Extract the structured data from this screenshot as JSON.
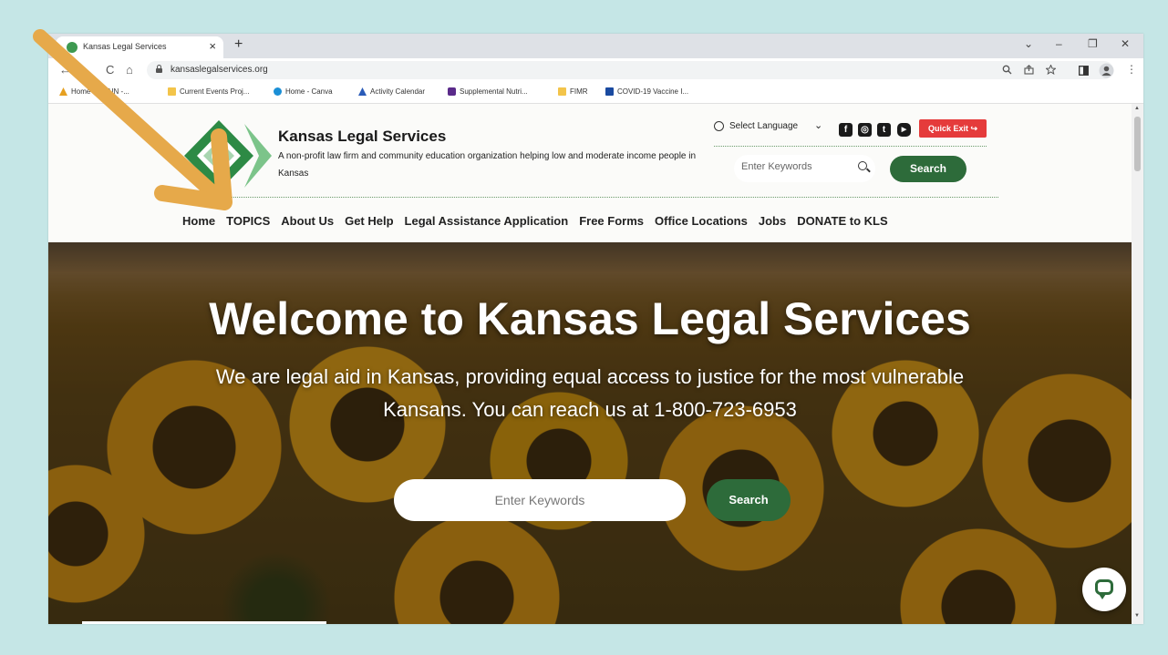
{
  "browser": {
    "tab_title": "Kansas Legal Services",
    "tab_close": "×",
    "new_tab": "+",
    "url": "kansaslegalservices.org",
    "window_controls": [
      "⌄",
      "–",
      "❐",
      "✕"
    ],
    "nav_icons": [
      "←",
      "C",
      "⌂"
    ],
    "bookmarks": [
      {
        "label": "Home - TRAIN -...",
        "icon": "train-icon",
        "color": "#e6a020"
      },
      {
        "label": "Current Events Proj...",
        "icon": "folder-icon",
        "color": "#f3c44a"
      },
      {
        "label": "Home - Canva",
        "icon": "canva-icon",
        "color": "#1a8fd6"
      },
      {
        "label": "Activity Calendar",
        "icon": "calendar-icon",
        "color": "#2a5bb8"
      },
      {
        "label": "Supplemental Nutri...",
        "icon": "bookmark-icon",
        "color": "#5a2a8a"
      },
      {
        "label": "FIMR",
        "icon": "folder-icon",
        "color": "#f3c44a"
      },
      {
        "label": "COVID-19 Vaccine I...",
        "icon": "bookmark-icon",
        "color": "#1a4aa0"
      }
    ]
  },
  "header": {
    "site_title": "Kansas Legal Services",
    "tagline": "A non-profit law firm and community education organization helping low and moderate income people in Kansas",
    "language_label": "Select Language",
    "language_chevron": "⌄",
    "social": [
      "f",
      "◎",
      "t",
      "▶"
    ],
    "quick_exit": "Quick Exit ↪",
    "search_placeholder": "Enter Keywords",
    "search_button": "Search"
  },
  "nav": [
    "Home",
    "TOPICS",
    "About Us",
    "Get Help",
    "Legal Assistance Application",
    "Free Forms",
    "Office Locations",
    "Jobs",
    "DONATE to KLS"
  ],
  "hero": {
    "title": "Welcome to Kansas Legal Services",
    "subtitle": "We are legal aid in Kansas, providing equal access to justice for the most vulnerable Kansans. You can reach us at 1-800-723-6953",
    "search_placeholder": "Enter Keywords",
    "search_button": "Search"
  },
  "colors": {
    "brand_green": "#2d6b3a",
    "quick_exit_red": "#e53b3b",
    "arrow_orange": "#e6a94a",
    "background": "#c5e6e6"
  }
}
